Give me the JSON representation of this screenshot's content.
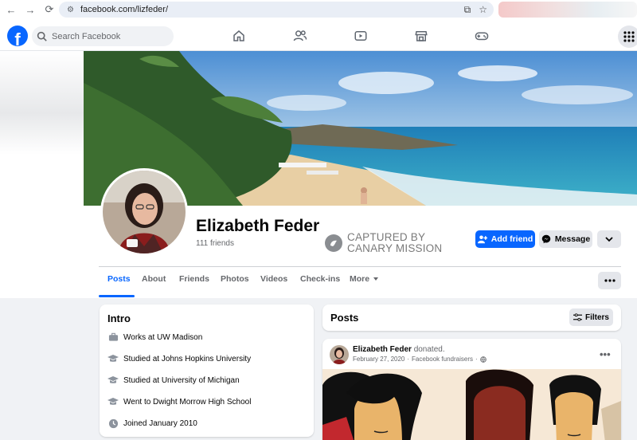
{
  "browser": {
    "url": "facebook.com/lizfeder/",
    "back_icon": "arrow-left",
    "forward_icon": "arrow-right",
    "reload_icon": "reload"
  },
  "fb": {
    "logo_letter": "f",
    "search_placeholder": "Search Facebook",
    "nav_icons": [
      "home-icon",
      "friends-icon",
      "video-icon",
      "marketplace-icon",
      "gaming-icon"
    ],
    "brand_color": "#0866ff"
  },
  "profile": {
    "name": "Elizabeth Feder",
    "friends": "111 friends",
    "stamp_line1": "CAPTURED BY",
    "stamp_line2": "CANARY MISSION",
    "add_friend_label": "Add friend",
    "message_label": "Message"
  },
  "tabs": [
    {
      "label": "Posts",
      "active": true
    },
    {
      "label": "About"
    },
    {
      "label": "Friends"
    },
    {
      "label": "Photos"
    },
    {
      "label": "Videos"
    },
    {
      "label": "Check-ins"
    },
    {
      "label": "More"
    }
  ],
  "intro": {
    "title": "Intro",
    "items": [
      {
        "icon": "briefcase-icon",
        "text": "Works at UW Madison"
      },
      {
        "icon": "graduation-cap-icon",
        "text": "Studied at Johns Hopkins University"
      },
      {
        "icon": "graduation-cap-icon",
        "text": "Studied at University of Michigan"
      },
      {
        "icon": "graduation-cap-icon",
        "text": "Went to Dwight Morrow High School"
      },
      {
        "icon": "clock-icon",
        "text": "Joined January 2010"
      }
    ]
  },
  "posts": {
    "title": "Posts",
    "filters_label": "Filters",
    "post": {
      "author": "Elizabeth Feder",
      "action": "donated.",
      "date": "February 27, 2020",
      "source": "Facebook fundraisers",
      "separator": "·"
    }
  }
}
